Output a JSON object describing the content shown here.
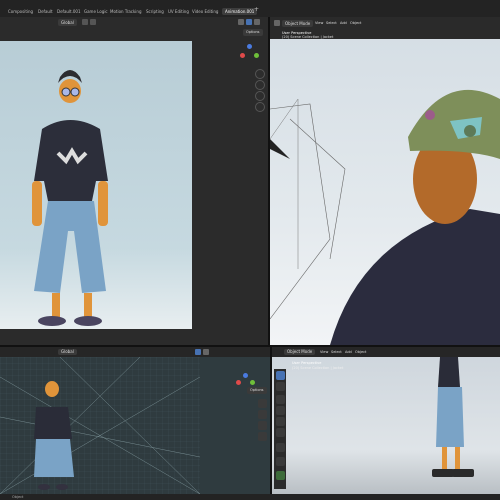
{
  "workspace_tabs": [
    "Compositing",
    "Default",
    "Default.001",
    "Game Logic",
    "Motion Tracking",
    "Scripting",
    "UV Editing",
    "Video Editing",
    "Animation.001"
  ],
  "active_tab": "Animation.001",
  "add_tab": "+",
  "header": {
    "transform_global": "Global",
    "options_label": "Options",
    "object_mode": "Object Mode",
    "menu_view": "View",
    "menu_select": "Select",
    "menu_add": "Add",
    "menu_object": "Object"
  },
  "viewport_info": {
    "line1": "User Perspective",
    "line2": "(20) Scene Collection | Jacket"
  },
  "status_bar": {
    "mode_label": "Object"
  },
  "colors": {
    "accent": "#4772b3",
    "axis_x": "#e04a4a",
    "axis_y": "#6fbf3a",
    "axis_z": "#4a7be0"
  },
  "icons": [
    "move-icon",
    "hand-icon",
    "camera-icon",
    "grid-icon",
    "zoom-icon",
    "cursor-icon",
    "rotate-icon",
    "scale-icon",
    "transform-icon",
    "annotate-icon",
    "measure-icon"
  ]
}
